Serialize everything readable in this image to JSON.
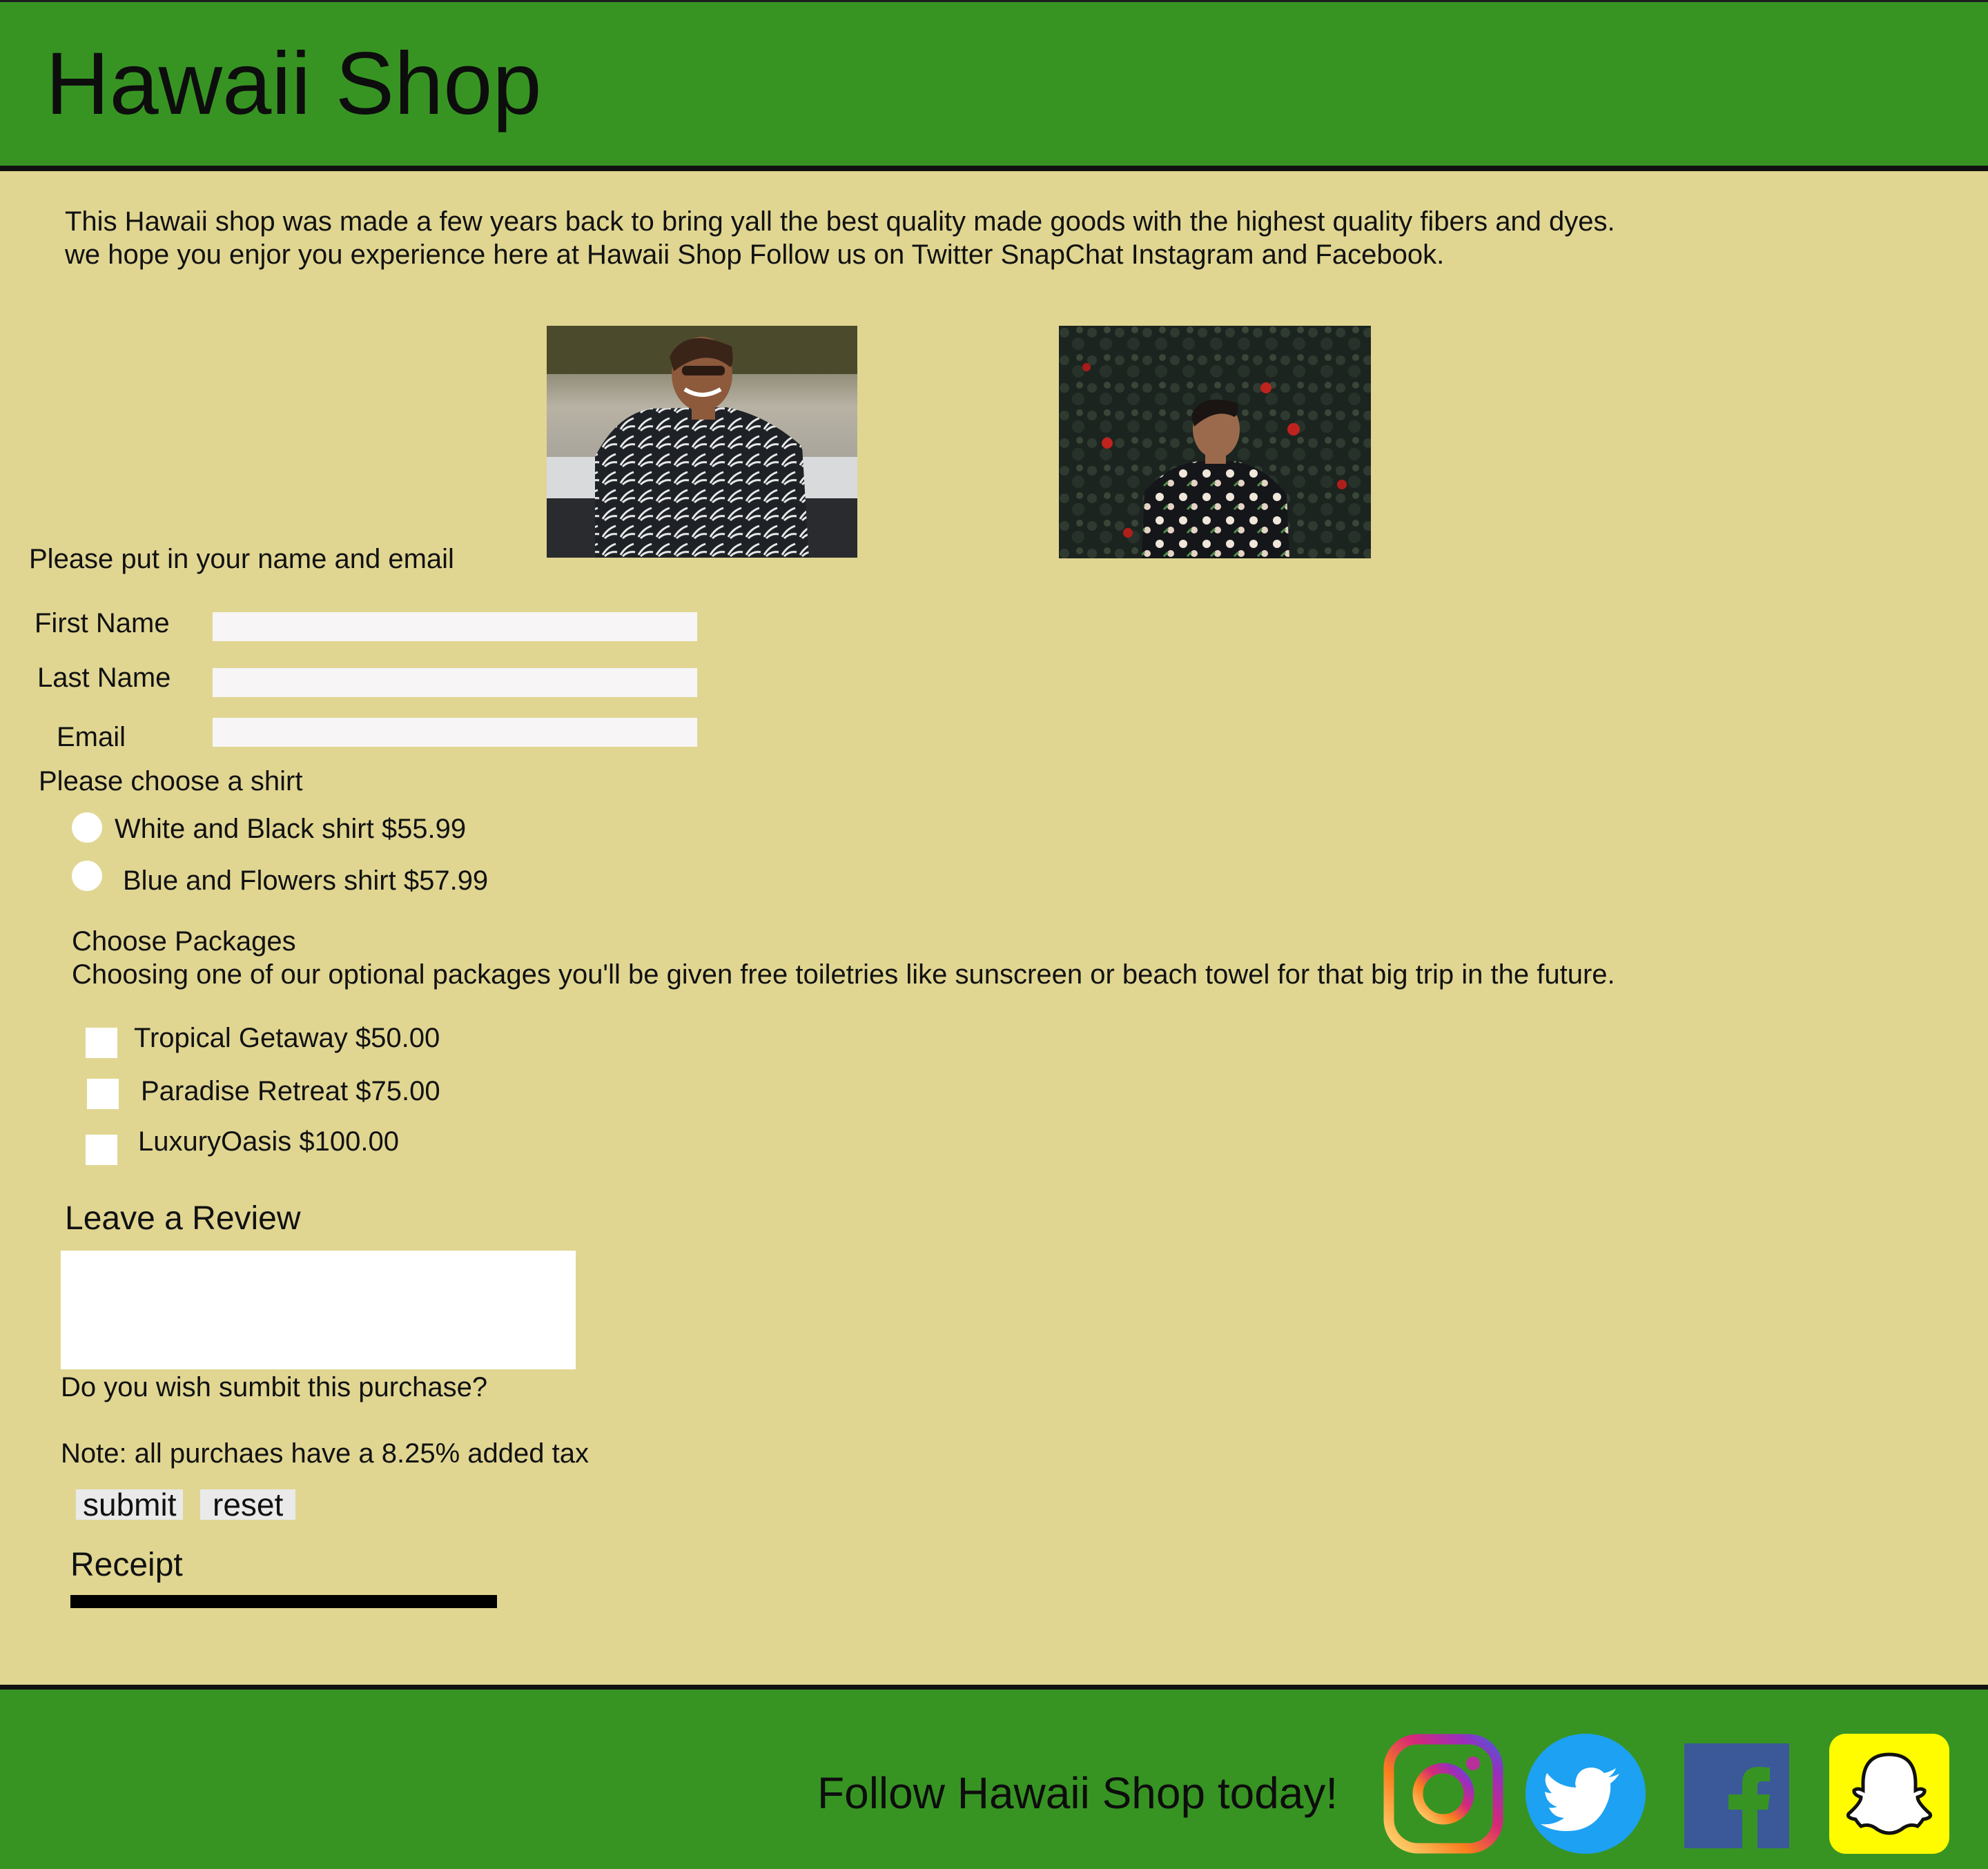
{
  "header": {
    "title": "Hawaii Shop"
  },
  "intro": {
    "text": "This Hawaii shop was made a few years back to bring yall the best quality made goods with the highest quality fibers and dyes. we hope you enjor you experience here at Hawaii Shop Follow us on Twitter SnapChat Instagram and Facebook."
  },
  "form": {
    "prompt": "Please put in your name and email",
    "first_name_label": "First Name",
    "last_name_label": "Last Name",
    "email_label": "Email",
    "first_name_value": "",
    "last_name_value": "",
    "email_value": ""
  },
  "shirts": {
    "heading": "Please choose a shirt",
    "options": [
      "White and Black shirt $55.99",
      "Blue and Flowers shirt $57.99"
    ]
  },
  "packages": {
    "heading": "Choose Packages",
    "description": "Choosing one of our optional packages you'll be given free toiletries like sunscreen or beach towel for that big trip in the future.",
    "options": [
      "Tropical Getaway $50.00",
      "Paradise Retreat $75.00",
      "LuxuryOasis $100.00"
    ]
  },
  "review": {
    "heading": "Leave a Review",
    "value": ""
  },
  "purchase": {
    "question": "Do you wish sumbit this purchase?",
    "note": "Note: all purchaes have a 8.25% added tax",
    "submit_label": "submit",
    "reset_label": "reset"
  },
  "receipt": {
    "heading": "Receipt"
  },
  "footer": {
    "follow_text": "Follow Hawaii Shop today!",
    "icons": [
      "instagram-icon",
      "twitter-icon",
      "facebook-icon",
      "snapchat-icon"
    ]
  },
  "colors": {
    "header_green": "#379423",
    "page_background": "#e0d692",
    "instagram_gradient": [
      "#feda75",
      "#d62976",
      "#962fbf",
      "#4f5bd5"
    ],
    "twitter_blue": "#1da1f2",
    "facebook_blue": "#3b5998",
    "snapchat_yellow": "#fffc00"
  }
}
